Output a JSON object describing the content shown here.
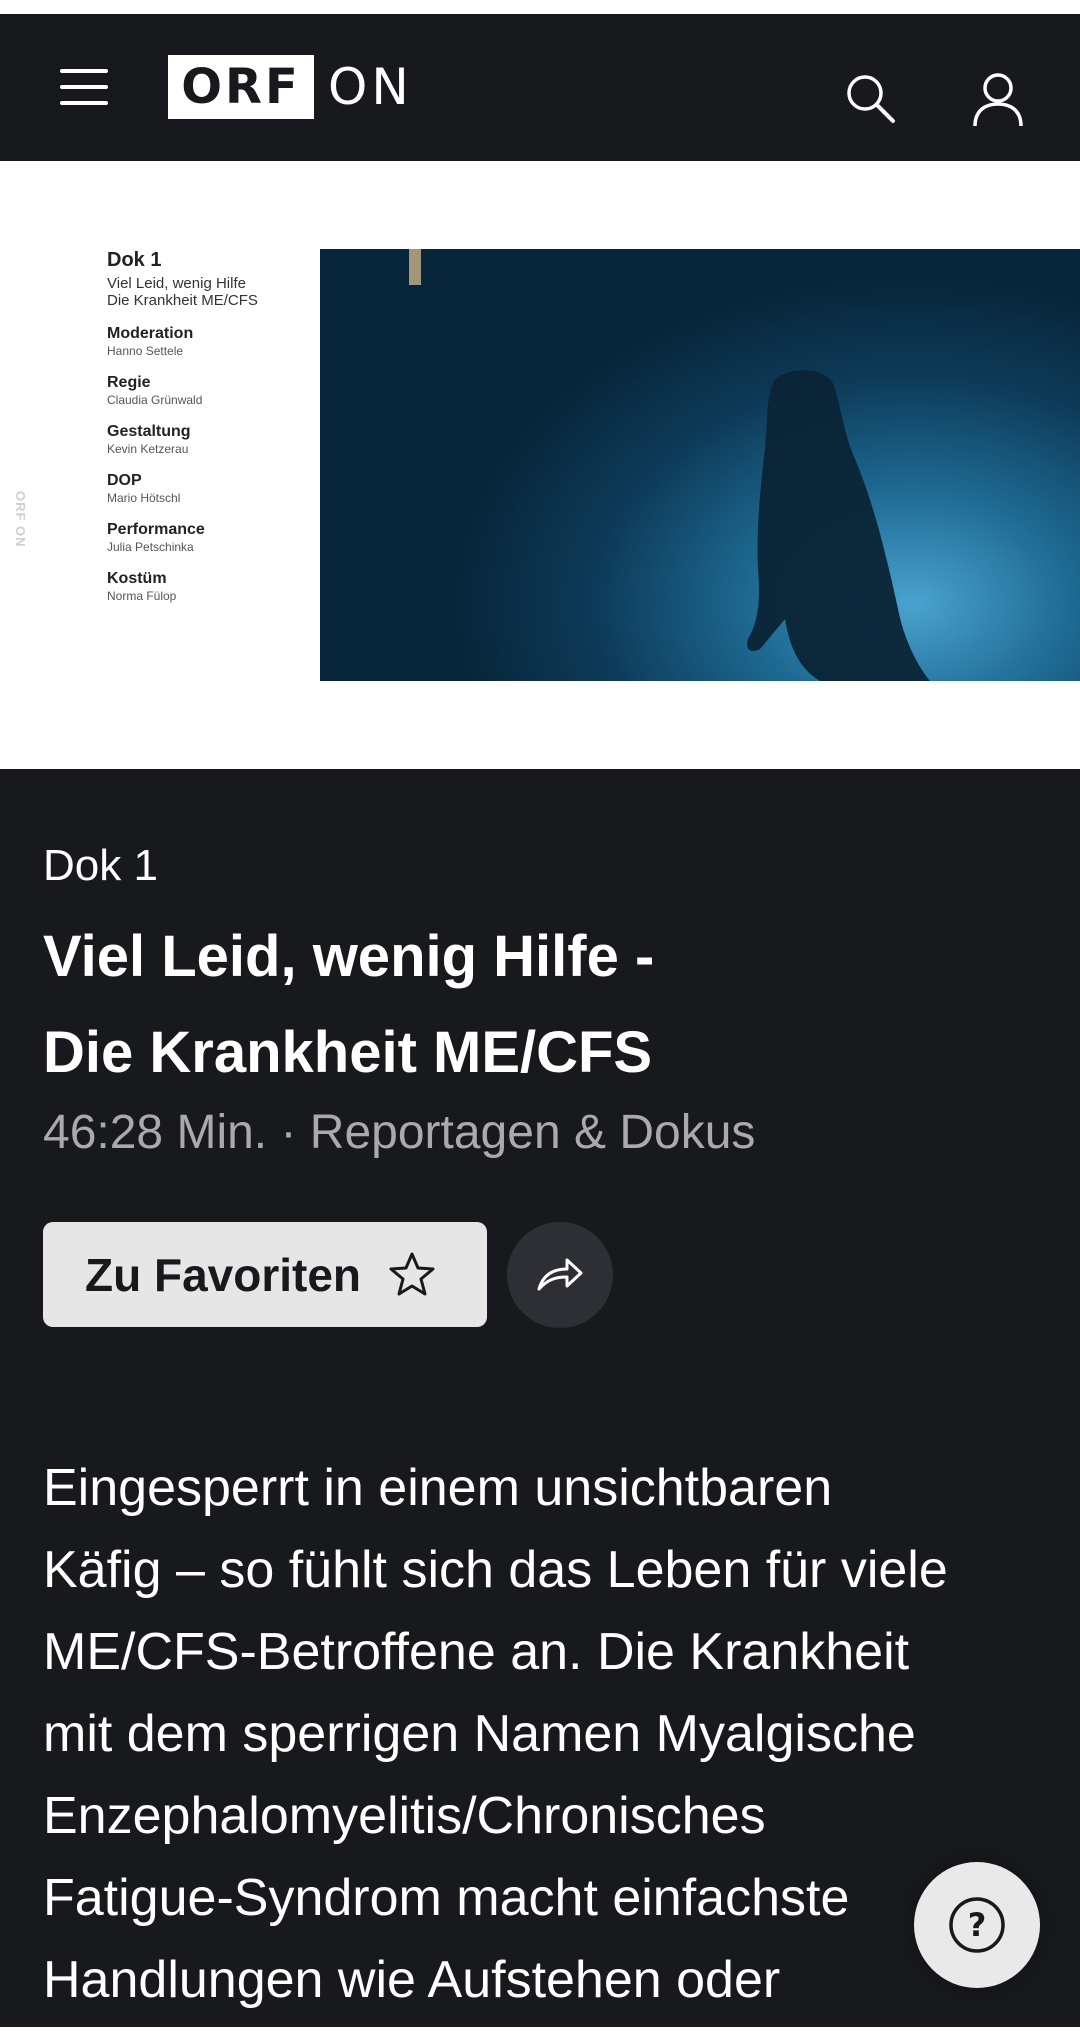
{
  "header": {
    "logo_left": "ORF",
    "logo_right": "ON",
    "menu_icon": "hamburger-menu-icon",
    "search_icon": "search-icon",
    "profile_icon": "user-profile-icon"
  },
  "hero": {
    "credits_title": "Dok 1",
    "credits_subtitle_line1": "Viel Leid, wenig Hilfe",
    "credits_subtitle_line2": "Die Krankheit ME/CFS",
    "credits": [
      {
        "role": "Moderation",
        "name": "Hanno Settele"
      },
      {
        "role": "Regie",
        "name": "Claudia Grünwald"
      },
      {
        "role": "Gestaltung",
        "name": "Kevin Ketzerau"
      },
      {
        "role": "DOP",
        "name": "Mario Hötschl"
      },
      {
        "role": "Performance",
        "name": "Julia Petschinka"
      },
      {
        "role": "Kostüm",
        "name": "Norma Fülop"
      }
    ],
    "watermark": "ORF ON"
  },
  "episode": {
    "series": "Dok 1",
    "title_line1": "Viel Leid, wenig Hilfe -",
    "title_line2": "Die Krankheit ME/CFS",
    "meta": "46:28 Min. · Reportagen & Dokus",
    "favorite_label": "Zu Favoriten",
    "favorite_icon": "star-outline-icon",
    "share_icon": "share-arrow-icon"
  },
  "description": {
    "lines": [
      "Eingesperrt in einem unsichtbaren",
      "Käfig – so fühlt sich das Leben für viele",
      "ME/CFS-Betroffene an. Die Krankheit",
      "mit dem sperrigen Namen Myalgische",
      "Enzephalomyelitis/Chronisches",
      "Fatigue-Syndrom macht einfachste",
      "Handlungen wie Aufstehen oder"
    ]
  },
  "help": {
    "icon": "help-question-icon",
    "symbol": "?"
  },
  "colors": {
    "background_dark": "#18191d",
    "button_light": "#e6e6e6",
    "meta_gray": "#a9a9ae"
  }
}
